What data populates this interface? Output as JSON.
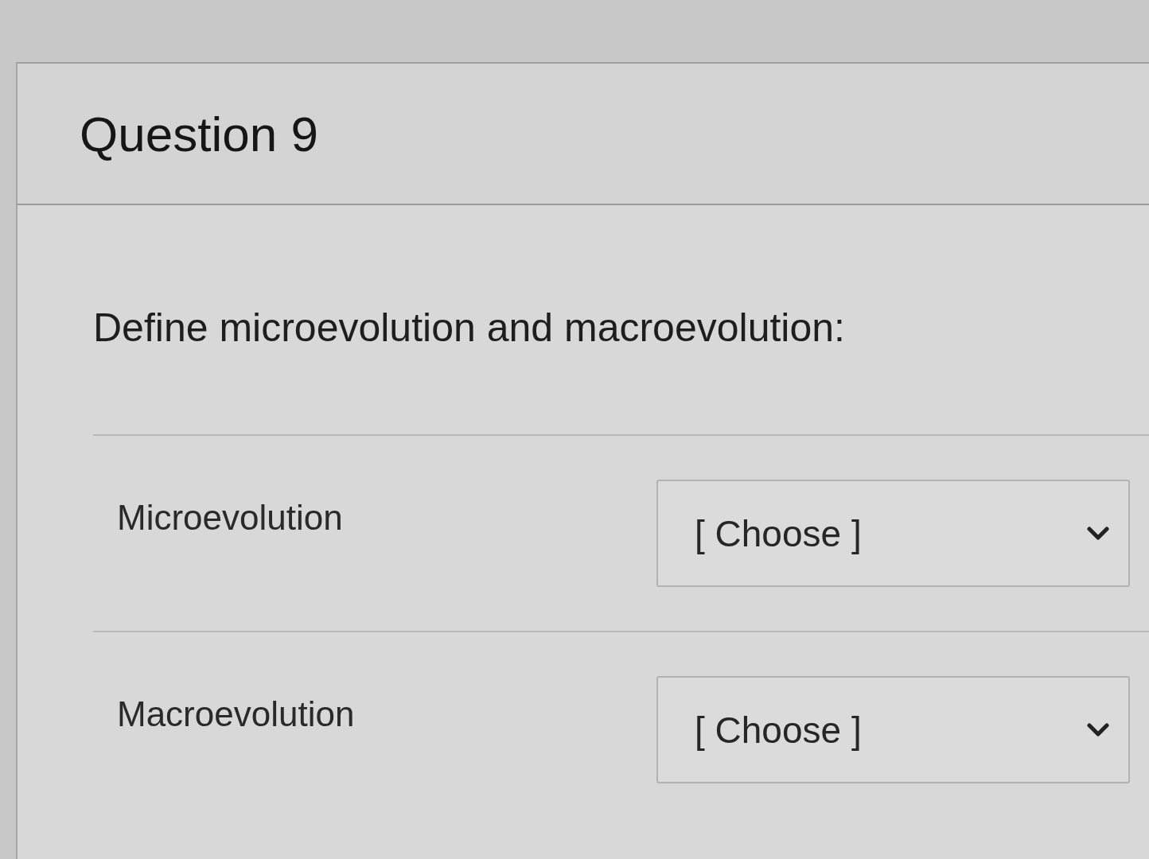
{
  "question": {
    "title": "Question 9",
    "prompt": "Define microevolution and macroevolution:",
    "matches": [
      {
        "label": "Microevolution",
        "placeholder": "[ Choose ]"
      },
      {
        "label": "Macroevolution",
        "placeholder": "[ Choose ]"
      }
    ]
  }
}
